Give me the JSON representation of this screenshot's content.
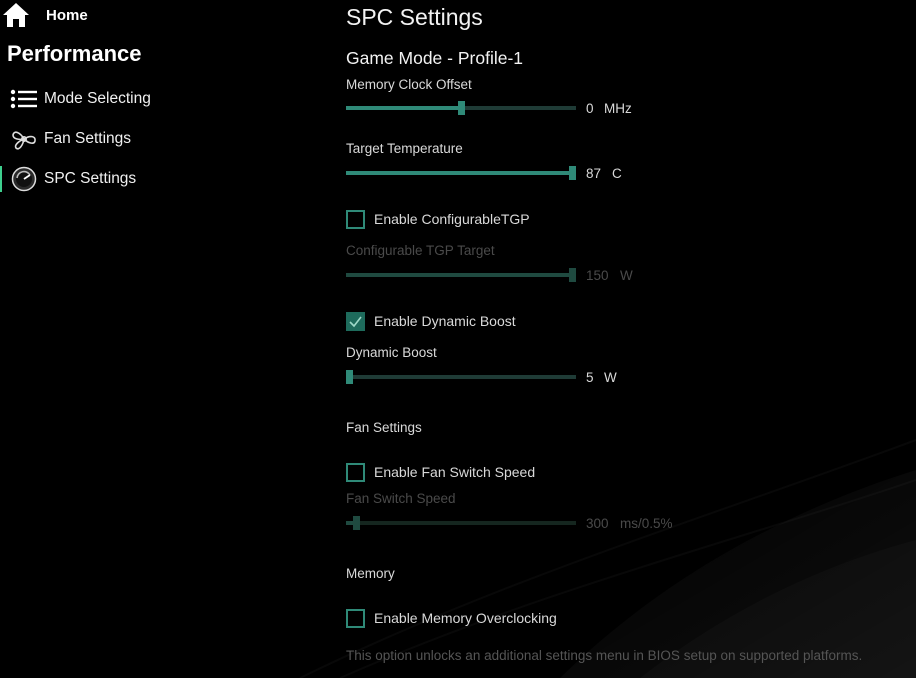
{
  "sidebar": {
    "home_label": "Home",
    "section_title": "Performance",
    "items": [
      {
        "label": "Mode Selecting",
        "icon": "list-icon"
      },
      {
        "label": "Fan Settings",
        "icon": "fan-icon"
      },
      {
        "label": "SPC Settings",
        "icon": "gauge-icon",
        "active": true
      }
    ]
  },
  "main": {
    "title": "SPC Settings",
    "profile": "Game Mode - Profile-1",
    "memory_clock": {
      "label": "Memory Clock Offset",
      "value": "0",
      "unit": "MHz",
      "fraction": 0.5
    },
    "target_temp": {
      "label": "Target Temperature",
      "value": "87",
      "unit": "C",
      "fraction": 1.0
    },
    "configurable_tgp_check": {
      "label": "Enable ConfigurableTGP",
      "checked": false
    },
    "configurable_tgp": {
      "label": "Configurable TGP Target",
      "value": "150",
      "unit": "W",
      "fraction": 1.0,
      "disabled": true
    },
    "dynamic_boost_check": {
      "label": "Enable Dynamic Boost",
      "checked": true
    },
    "dynamic_boost": {
      "label": "Dynamic Boost",
      "value": "5",
      "unit": "W",
      "fraction": 0.0
    },
    "fan_section": "Fan Settings",
    "fan_switch_check": {
      "label": "Enable Fan Switch Speed",
      "checked": false
    },
    "fan_switch": {
      "label": "Fan Switch Speed",
      "value": "300",
      "unit": "ms/0.5%",
      "fraction": 0.03,
      "disabled": true
    },
    "memory_section": "Memory",
    "memory_oc_check": {
      "label": "Enable Memory Overclocking",
      "checked": false
    },
    "memory_note": "This option unlocks an additional settings menu in BIOS setup on supported platforms."
  },
  "colors": {
    "accent": "#2f8a78",
    "track": "#1f3b36",
    "active_indicator": "#3ecf8e"
  }
}
